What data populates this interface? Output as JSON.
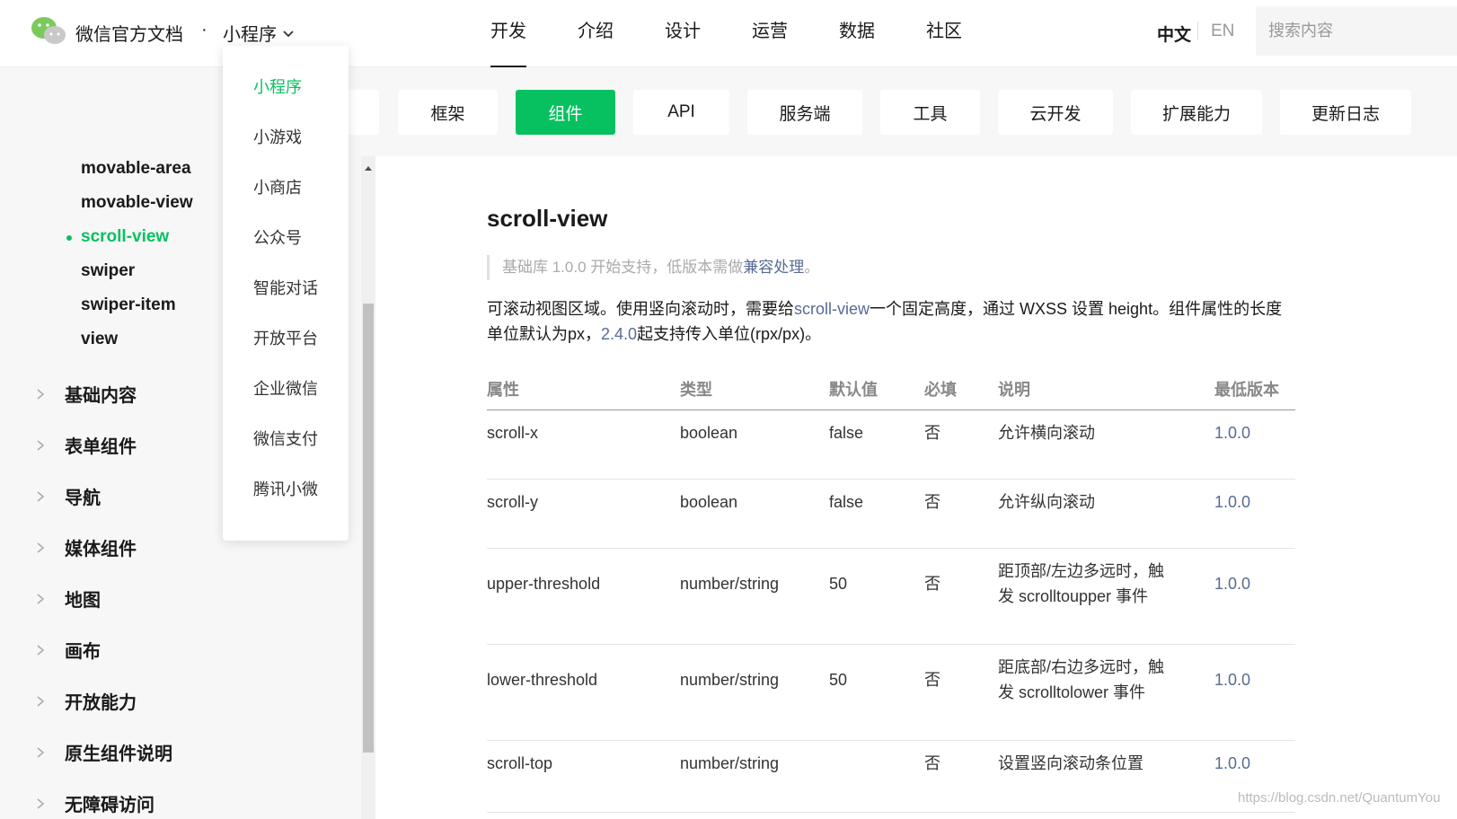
{
  "header": {
    "brand": "微信官方文档",
    "brand_separator": "·",
    "product_menu": "小程序",
    "nav": [
      "开发",
      "介绍",
      "设计",
      "运营",
      "数据",
      "社区"
    ],
    "lang_zh": "中文",
    "lang_en": "EN",
    "search_placeholder": "搜索内容"
  },
  "product_dropdown": {
    "items": [
      "小程序",
      "小游戏",
      "小商店",
      "公众号",
      "智能对话",
      "开放平台",
      "企业微信",
      "微信支付",
      "腾讯小微"
    ],
    "active": "小程序"
  },
  "subnav": {
    "items": [
      "框架",
      "组件",
      "API",
      "服务端",
      "工具",
      "云开发",
      "扩展能力",
      "更新日志"
    ],
    "active": "组件"
  },
  "sidebar": {
    "sub_items": [
      "movable-area",
      "movable-view",
      "scroll-view",
      "swiper",
      "swiper-item",
      "view"
    ],
    "active_sub": "scroll-view",
    "groups": [
      "基础内容",
      "表单组件",
      "导航",
      "媒体组件",
      "地图",
      "画布",
      "开放能力",
      "原生组件说明",
      "无障碍访问"
    ]
  },
  "content": {
    "title": "scroll-view",
    "note_prefix": "基础库 1.0.0 开始支持，低版本需做",
    "note_link": "兼容处理",
    "note_suffix": "。",
    "desc_part1": "可滚动视图区域。使用竖向滚动时，需要给",
    "desc_link1": "scroll-view",
    "desc_part2": "一个固定高度，通过 WXSS 设置 height。组件属性的长度单位默认为px，",
    "desc_link2": "2.4.0",
    "desc_part3": "起支持传入单位(rpx/px)。"
  },
  "table": {
    "headers": [
      "属性",
      "类型",
      "默认值",
      "必填",
      "说明",
      "最低版本"
    ],
    "rows": [
      {
        "attr": "scroll-x",
        "type": "boolean",
        "default": "false",
        "required": "否",
        "desc1": "允许横向滚动",
        "desc2": "",
        "version": "1.0.0"
      },
      {
        "attr": "scroll-y",
        "type": "boolean",
        "default": "false",
        "required": "否",
        "desc1": "允许纵向滚动",
        "desc2": "",
        "version": "1.0.0"
      },
      {
        "attr": "upper-threshold",
        "type": "number/string",
        "default": "50",
        "required": "否",
        "desc1": "距顶部/左边多远时，触",
        "desc2": "发 scrolltoupper 事件",
        "version": "1.0.0"
      },
      {
        "attr": "lower-threshold",
        "type": "number/string",
        "default": "50",
        "required": "否",
        "desc1": "距底部/右边多远时，触",
        "desc2": "发 scrolltolower 事件",
        "version": "1.0.0"
      },
      {
        "attr": "scroll-top",
        "type": "number/string",
        "default": "",
        "required": "否",
        "desc1": "设置竖向滚动条位置",
        "desc2": "",
        "version": "1.0.0"
      }
    ]
  },
  "watermark": "https://blog.csdn.net/QuantumYou",
  "colors": {
    "accent": "#07c160",
    "link": "#576b95"
  }
}
